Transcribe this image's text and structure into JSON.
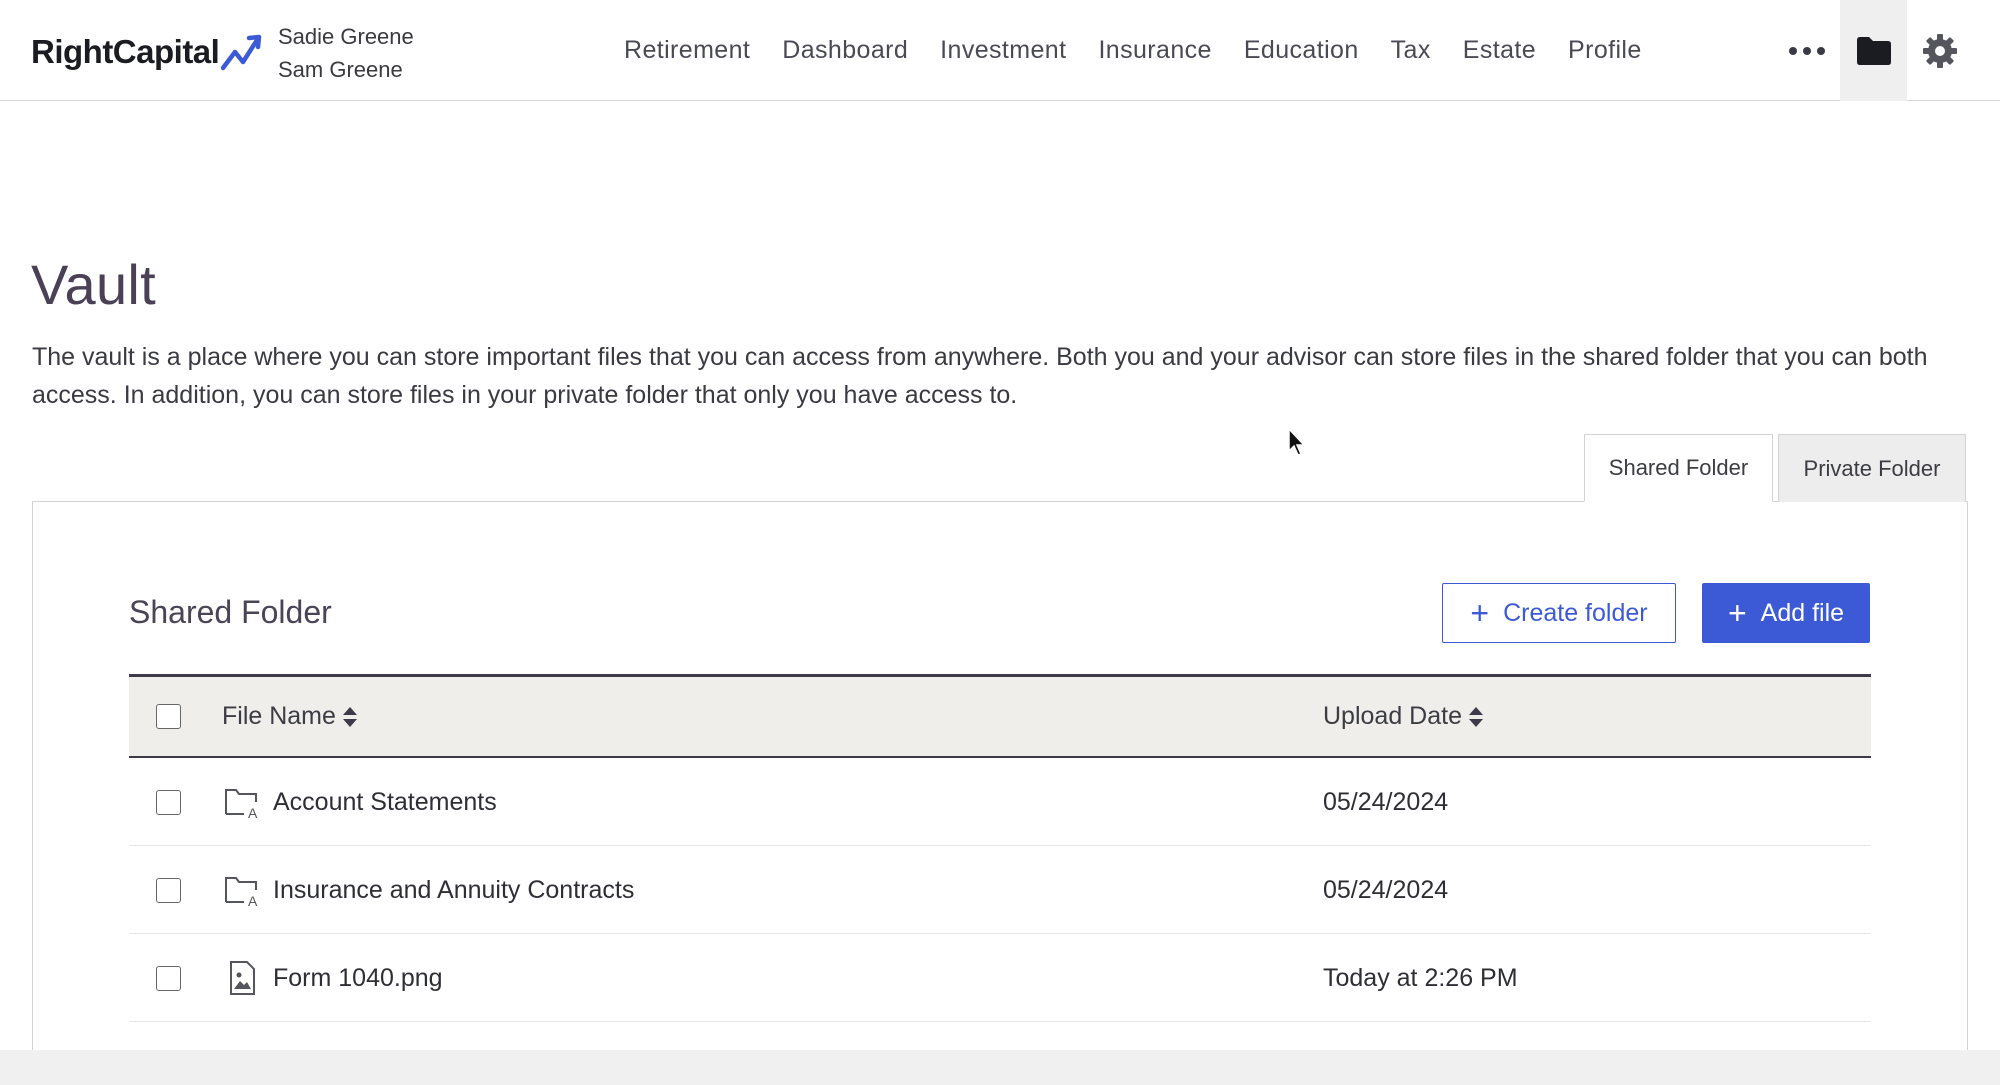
{
  "header": {
    "logo_text": "RightCapital",
    "client_names": [
      "Sadie Greene",
      "Sam Greene"
    ],
    "nav": [
      "Retirement",
      "Dashboard",
      "Investment",
      "Insurance",
      "Education",
      "Tax",
      "Estate",
      "Profile"
    ],
    "more_icon": "more-horizontal-icon",
    "folder_icon": "folder-icon",
    "settings_icon": "gear-icon"
  },
  "page": {
    "title": "Vault",
    "description": "The vault is a place where you can store important files that you can access from anywhere. Both you and your advisor can store files in the shared folder that you can both access. In addition, you can store files in your private folder that only you have access to."
  },
  "tabs": [
    "Shared Folder",
    "Private Folder"
  ],
  "active_tab": "Shared Folder",
  "panel": {
    "title": "Shared Folder",
    "create_folder_label": "Create folder",
    "add_file_label": "Add file"
  },
  "table": {
    "columns": [
      "File Name",
      "Upload Date"
    ],
    "rows": [
      {
        "type": "folder",
        "name": "Account Statements",
        "date": "05/24/2024"
      },
      {
        "type": "folder",
        "name": "Insurance and Annuity Contracts",
        "date": "05/24/2024"
      },
      {
        "type": "image-file",
        "name": "Form 1040.png",
        "date": "Today at 2:26 PM"
      }
    ]
  },
  "colors": {
    "accent": "#3d5ad6",
    "header_text": "#4a4a55",
    "table_header_bg": "#efeeea"
  }
}
